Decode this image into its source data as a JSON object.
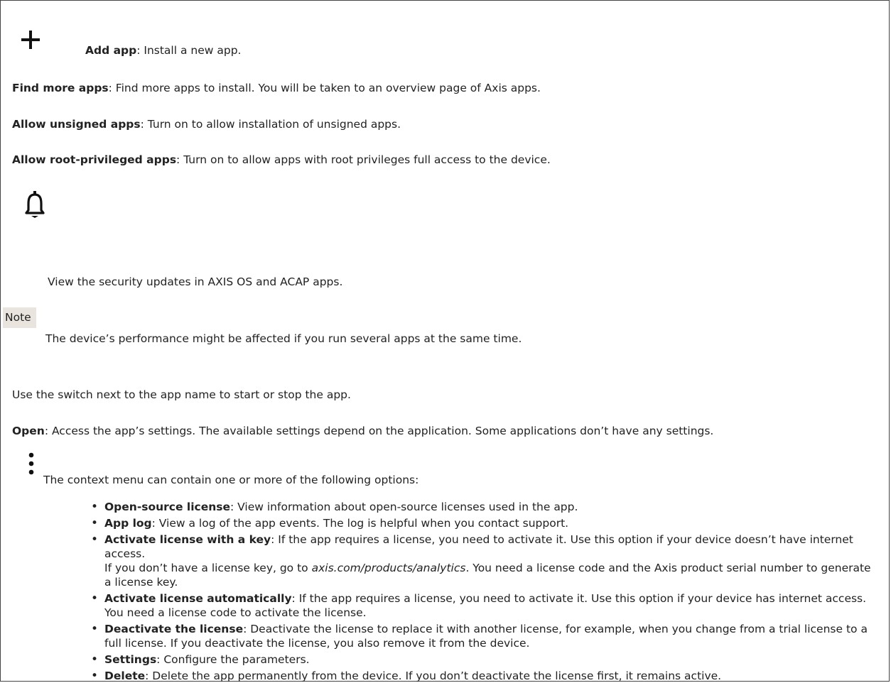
{
  "add_app": {
    "icon": "plus-icon",
    "title": "Add app",
    "desc": ": Install a new app."
  },
  "find_more": {
    "title": "Find more apps",
    "desc": ": Find more apps to install. You will be taken to an overview page of Axis apps."
  },
  "allow_unsigned": {
    "title": "Allow unsigned apps",
    "desc": ": Turn on to allow installation of unsigned apps."
  },
  "allow_root": {
    "title": "Allow root-privileged apps",
    "desc": ": Turn on to allow apps with root privileges full access to the device."
  },
  "security": {
    "icon": "bell-icon",
    "text": "View the security updates in AXIS OS and ACAP apps."
  },
  "note": {
    "label": "Note",
    "text": "The device’s performance might be affected if you run several apps at the same time."
  },
  "switch_text": "Use the switch next to the app name to start or stop the app.",
  "open": {
    "title": "Open",
    "desc": ": Access the app’s settings. The available settings depend on the application. Some applications don’t have any settings."
  },
  "context": {
    "icon": "more-vertical-icon",
    "text": "The context menu can contain one or more of the following options:"
  },
  "options": [
    {
      "title": "Open-source license",
      "desc": ": View information about open-source licenses used in the app."
    },
    {
      "title": "App log",
      "desc": ": View a log of the app events. The log is helpful when you contact support."
    },
    {
      "title": "Activate license with a key",
      "desc": ": If the app requires a license, you need to activate it. Use this option if your device doesn’t have internet access.",
      "sub_pre": "If you don’t have a license key, go to ",
      "sub_link": "axis.com/products/analytics",
      "sub_post": ". You need a license code and the Axis product serial number to generate a license key."
    },
    {
      "title": "Activate license automatically",
      "desc": ": If the app requires a license, you need to activate it. Use this option if your device has internet access. You need a license code to activate the license."
    },
    {
      "title": "Deactivate the license",
      "desc": ": Deactivate the license to replace it with another license, for example, when you change from a trial license to a full license. If you deactivate the license, you also remove it from the device."
    },
    {
      "title": "Settings",
      "desc": ": Configure the parameters."
    },
    {
      "title": "Delete",
      "desc": ": Delete the app permanently from the device. If you don’t deactivate the license first, it remains active."
    }
  ]
}
